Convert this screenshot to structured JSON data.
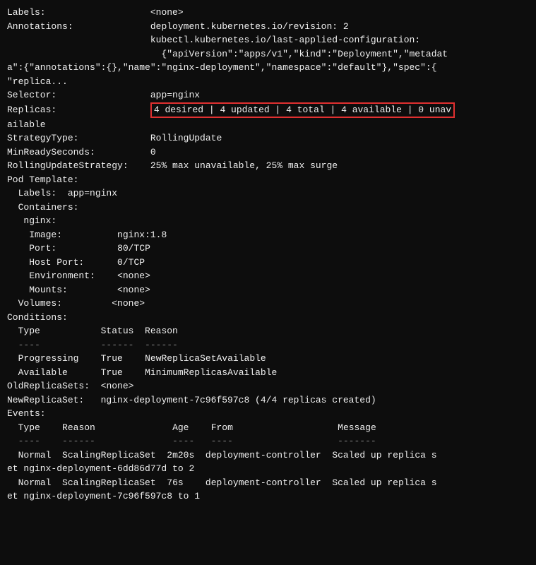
{
  "terminal": {
    "lines": [
      {
        "id": "labels",
        "indent": 0,
        "label": "Labels:",
        "value": "          <none>"
      },
      {
        "id": "annotations-1",
        "indent": 0,
        "label": "Annotations:",
        "value": "       deployment.kubernetes.io/revision: 2"
      },
      {
        "id": "annotations-2",
        "indent": 0,
        "label": "",
        "value": "                   kubectl.kubernetes.io/last-applied-configuration:"
      },
      {
        "id": "annotations-3",
        "indent": 0,
        "label": "",
        "value": "                     {\"apiVersion\":\"apps/v1\",\"kind\":\"Deployment\",\"metadat"
      },
      {
        "id": "annotations-4",
        "indent": 0,
        "label": "",
        "value": "a\":{\"annotations\":{},\"name\":\"nginx-deployment\",\"namespace\":\"default\"},\"spec\":{"
      },
      {
        "id": "annotations-5",
        "indent": 0,
        "label": "",
        "value": "\"replica..."
      },
      {
        "id": "selector",
        "indent": 0,
        "label": "Selector:",
        "value": "          app=nginx"
      },
      {
        "id": "replicas-highlight",
        "type": "highlight"
      },
      {
        "id": "replicas-cont",
        "indent": 0,
        "label": "",
        "value": "ailable"
      },
      {
        "id": "strategy",
        "indent": 0,
        "label": "StrategyType:",
        "value": "        RollingUpdate"
      },
      {
        "id": "minready",
        "indent": 0,
        "label": "MinReadySeconds:",
        "value": "      0"
      },
      {
        "id": "rolling",
        "indent": 0,
        "label": "RollingUpdateStrategy:",
        "value": "  25% max unavailable, 25% max surge"
      },
      {
        "id": "pod-template",
        "indent": 0,
        "label": "Pod Template:",
        "value": ""
      },
      {
        "id": "labels2",
        "indent": 1,
        "label": "  Labels:",
        "value": "  app=nginx"
      },
      {
        "id": "containers",
        "indent": 1,
        "label": "  Containers:",
        "value": ""
      },
      {
        "id": "nginx",
        "indent": 2,
        "label": "   nginx:",
        "value": ""
      },
      {
        "id": "image",
        "indent": 3,
        "label": "    Image:",
        "value": "       nginx:1.8"
      },
      {
        "id": "port",
        "indent": 3,
        "label": "    Port:",
        "value": "        80/TCP"
      },
      {
        "id": "hostport",
        "indent": 3,
        "label": "    Host Port:",
        "value": "   0/TCP"
      },
      {
        "id": "env",
        "indent": 3,
        "label": "    Environment:",
        "value": "  <none>"
      },
      {
        "id": "mounts",
        "indent": 3,
        "label": "    Mounts:",
        "value": "      <none>"
      },
      {
        "id": "volumes",
        "indent": 1,
        "label": "  Volumes:",
        "value": "       <none>"
      },
      {
        "id": "conditions",
        "indent": 0,
        "label": "Conditions:",
        "value": ""
      },
      {
        "id": "cond-header",
        "indent": 1,
        "label": "  Type",
        "value": "           Status  Reason"
      },
      {
        "id": "cond-sep",
        "indent": 1,
        "label": "  ----",
        "value": "           ------  ------"
      },
      {
        "id": "cond-prog",
        "indent": 1,
        "label": "  Progressing",
        "value": "   True    NewReplicaSetAvailable"
      },
      {
        "id": "cond-avail",
        "indent": 1,
        "label": "  Available",
        "value": "     True    MinimumReplicasAvailable"
      },
      {
        "id": "oldreplica",
        "indent": 0,
        "label": "OldReplicaSets:",
        "value": "  <none>"
      },
      {
        "id": "newreplica",
        "indent": 0,
        "label": "NewReplicaSet:",
        "value": "   nginx-deployment-7c96f597c8 (4/4 replicas created)"
      },
      {
        "id": "events",
        "indent": 0,
        "label": "Events:",
        "value": ""
      },
      {
        "id": "evt-header",
        "indent": 1,
        "label": "  Type",
        "value": "    Reason              Age    From                   Message"
      },
      {
        "id": "evt-sep",
        "indent": 1,
        "label": "  ----",
        "value": "    ------              ----   ----                   -------"
      },
      {
        "id": "evt1",
        "indent": 1,
        "label": "  Normal",
        "value": "  ScalingReplicaSet  2m20s  deployment-controller  Scaled up replica s"
      },
      {
        "id": "evt1-cont",
        "indent": 0,
        "label": "",
        "value": "et nginx-deployment-6dd86d77d to 2"
      },
      {
        "id": "evt2",
        "indent": 1,
        "label": "  Normal",
        "value": "  ScalingReplicaSet  76s    deployment-controller  Scaled up replica s"
      },
      {
        "id": "evt2-cont",
        "indent": 0,
        "label": "",
        "value": "et nginx-deployment-7c96f597c8 to 1"
      }
    ],
    "replicas": {
      "label": "Replicas:",
      "value": "4 desired | 4 updated | 4 total | 4 available | 0 unav"
    }
  }
}
